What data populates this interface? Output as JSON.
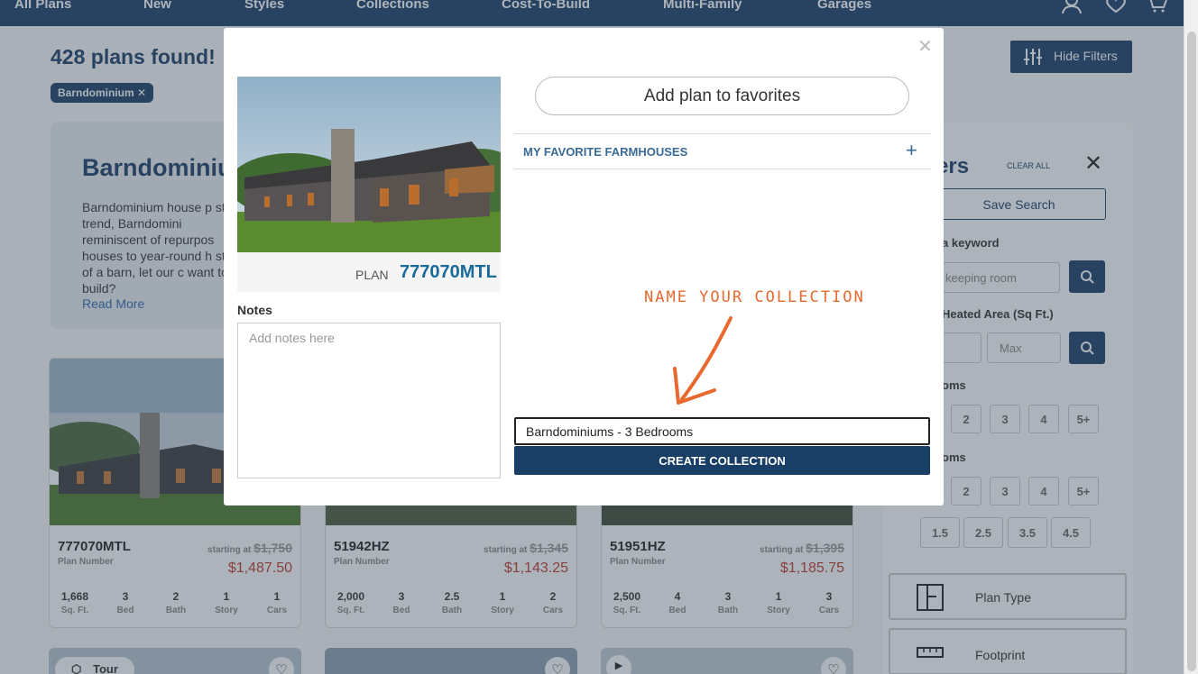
{
  "nav": {
    "items": [
      "All Plans",
      "New",
      "Styles",
      "Collections",
      "Cost-To-Build",
      "Multi-Family",
      "Garages"
    ]
  },
  "results": {
    "count_text": "428 plans found!",
    "chip_label": "Barndominium",
    "hide_filters": "Hide Filters"
  },
  "intro": {
    "title": "Barndominium",
    "text": "Barndominium house p style trend, Barndomini reminiscent of repurpos houses to year-round h style of a barn, let our c want to build?",
    "read_more": "Read More"
  },
  "cards": [
    {
      "plan": "777070MTL",
      "plan_label": "Plan Number",
      "starting": "starting at",
      "old_price": "$1,750",
      "price": "$1,487.50",
      "stats": [
        {
          "v": "1,668",
          "l": "Sq. Ft."
        },
        {
          "v": "3",
          "l": "Bed"
        },
        {
          "v": "2",
          "l": "Bath"
        },
        {
          "v": "1",
          "l": "Story"
        },
        {
          "v": "1",
          "l": "Cars"
        }
      ]
    },
    {
      "plan": "51942HZ",
      "plan_label": "Plan Number",
      "starting": "starting at",
      "old_price": "$1,345",
      "price": "$1,143.25",
      "stats": [
        {
          "v": "2,000",
          "l": "Sq. Ft."
        },
        {
          "v": "3",
          "l": "Bed"
        },
        {
          "v": "2.5",
          "l": "Bath"
        },
        {
          "v": "1",
          "l": "Story"
        },
        {
          "v": "2",
          "l": "Cars"
        }
      ]
    },
    {
      "plan": "51951HZ",
      "plan_label": "Plan Number",
      "starting": "starting at",
      "old_price": "$1,395",
      "price": "$1,185.75",
      "stats": [
        {
          "v": "2,500",
          "l": "Sq. Ft."
        },
        {
          "v": "4",
          "l": "Bed"
        },
        {
          "v": "3",
          "l": "Bath"
        },
        {
          "v": "1",
          "l": "Story"
        },
        {
          "v": "3",
          "l": "Cars"
        }
      ]
    }
  ],
  "tour_label": "Tour",
  "filters": {
    "title": "ers",
    "clear_all": "CLEAR ALL",
    "save_search": "Save Search",
    "keyword_label": "a keyword",
    "keyword_placeholder": "keeping room",
    "area_label": "Heated Area (Sq Ft.)",
    "max_placeholder": "Max",
    "bedrooms_label": "oms",
    "bathrooms_label": "oms",
    "bed_options": [
      "2",
      "3",
      "4",
      "5+"
    ],
    "bath_options": [
      "2",
      "3",
      "4",
      "5+"
    ],
    "half_options": [
      "1.5",
      "2.5",
      "3.5",
      "4.5"
    ],
    "plan_type": "Plan Type",
    "footprint": "Footprint"
  },
  "modal": {
    "plan_label": "PLAN",
    "plan_code": "777070MTL",
    "notes_label": "Notes",
    "notes_placeholder": "Add notes here",
    "add_favorites": "Add plan to favorites",
    "collection_name": "MY FAVORITE FARMHOUSES",
    "hint": "NAME YOUR COLLECTION",
    "new_collection_value": "Barndominiums - 3 Bedrooms",
    "create_button": "CREATE COLLECTION"
  },
  "colors": {
    "navy": "#1a3f66",
    "accent_blue": "#3a6a96",
    "price_red": "#c0392b",
    "hint_orange": "#e8692f"
  }
}
